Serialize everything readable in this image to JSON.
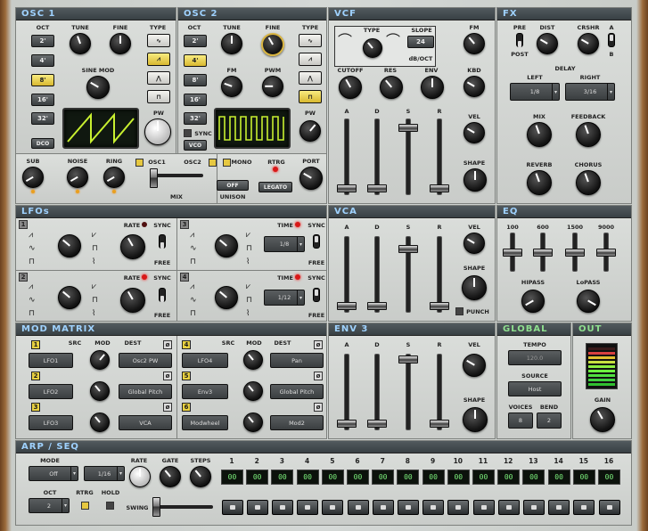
{
  "osc1": {
    "title": "OSC 1",
    "oct_label": "OCT",
    "oct_values": [
      "2'",
      "4'",
      "8'",
      "16'",
      "32'"
    ],
    "oct_selected": 2,
    "tune": "TUNE",
    "fine": "FINE",
    "type": "TYPE",
    "sine_mod": "SINE MOD",
    "pw": "PW",
    "dco": "DCO"
  },
  "osc2": {
    "title": "OSC 2",
    "oct_label": "OCT",
    "oct_values": [
      "2'",
      "4'",
      "8'",
      "16'",
      "32'"
    ],
    "oct_selected": 1,
    "tune": "TUNE",
    "fine": "FINE",
    "type": "TYPE",
    "fm": "FM",
    "pwm": "PWM",
    "pw": "PW",
    "sync": "SYNC",
    "vco": "VCO"
  },
  "mixer": {
    "sub": "SUB",
    "noise": "NOISE",
    "ring": "RING",
    "osc1": "OSC1",
    "osc2": "OSC2",
    "mix": "MIX",
    "mono": "MONO",
    "rtrg": "RTRG",
    "port": "PORT",
    "off": "OFF",
    "unison": "UNISON",
    "legato": "LEGATO"
  },
  "vcf": {
    "title": "VCF",
    "type": "TYPE",
    "slope": "SLOPE",
    "slope_value": "24",
    "db_oct": "dB/OCT",
    "fm": "FM",
    "cutoff": "CUTOFF",
    "res": "RES",
    "env": "ENV",
    "kbd": "KBD",
    "vel": "VEL",
    "shape": "SHAPE",
    "a": "A",
    "d": "D",
    "s": "S",
    "r": "R"
  },
  "fx": {
    "title": "FX",
    "pre": "PRE",
    "post": "POST",
    "dist": "DIST",
    "crshr": "CRSHR",
    "a": "A",
    "b": "B",
    "delay": "DELAY",
    "left": "LEFT",
    "left_value": "1/8",
    "right": "RIGHT",
    "right_value": "3/16",
    "mix": "MIX",
    "feedback": "FEEDBACK",
    "reverb": "REVERB",
    "chorus": "CHORUS"
  },
  "lfos": {
    "title": "LFOs",
    "rate": "RATE",
    "time": "TIME",
    "sync": "SYNC",
    "free": "FREE",
    "lfo3_value": "1/8",
    "lfo4_value": "1/12",
    "n1": "1",
    "n2": "2",
    "n3": "3",
    "n4": "4"
  },
  "vca": {
    "title": "VCA",
    "a": "A",
    "d": "D",
    "s": "S",
    "r": "R",
    "vel": "VEL",
    "shape": "SHAPE",
    "punch": "PUNCH"
  },
  "eq": {
    "title": "EQ",
    "f1": "100",
    "f2": "600",
    "f3": "1500",
    "f4": "9000",
    "hipass": "HIPASS",
    "lopass": "LoPASS"
  },
  "mod": {
    "title": "MOD MATRIX",
    "src": "SRC",
    "mod": "MOD",
    "dest": "DEST",
    "rows": [
      {
        "n": "1",
        "src": "LFO1",
        "dest": "Osc2 PW"
      },
      {
        "n": "2",
        "src": "LFO2",
        "dest": "Global Pitch"
      },
      {
        "n": "3",
        "src": "LFO3",
        "dest": "VCA"
      },
      {
        "n": "4",
        "src": "LFO4",
        "dest": "Pan"
      },
      {
        "n": "5",
        "src": "Env3",
        "dest": "Global Pitch"
      },
      {
        "n": "6",
        "src": "Modwheel",
        "dest": "Mod2"
      }
    ]
  },
  "env3": {
    "title": "ENV 3",
    "a": "A",
    "d": "D",
    "s": "S",
    "r": "R",
    "vel": "VEL",
    "shape": "SHAPE"
  },
  "global": {
    "title": "GLOBAL",
    "tempo": "TEMPO",
    "tempo_value": "120.0",
    "source": "SOURCE",
    "source_value": "Host",
    "voices": "VOICES",
    "bend": "BEND",
    "voices_value": "8",
    "bend_value": "2"
  },
  "out": {
    "title": "OUT",
    "gain": "GAIN"
  },
  "arp": {
    "title": "ARP / SEQ",
    "mode": "MODE",
    "mode_value": "Off",
    "rate": "RATE",
    "rate_value": "1/16",
    "gate": "GATE",
    "steps": "STEPS",
    "oct": "OCT",
    "oct_value": "2",
    "rtrg": "RTRG",
    "hold": "HOLD",
    "swing": "SWING",
    "step_numbers": [
      "1",
      "2",
      "3",
      "4",
      "5",
      "6",
      "7",
      "8",
      "9",
      "10",
      "11",
      "12",
      "13",
      "14",
      "15",
      "16"
    ],
    "step_values": [
      "00",
      "00",
      "00",
      "00",
      "00",
      "00",
      "00",
      "00",
      "00",
      "00",
      "00",
      "00",
      "00",
      "00",
      "00",
      "00"
    ]
  },
  "colors": {
    "header_text": "#9fd2ff",
    "global_text": "#8fe08f",
    "led_on": "#e8a020",
    "button_on": "#e8d040",
    "scope_trace": "#c8f030"
  }
}
